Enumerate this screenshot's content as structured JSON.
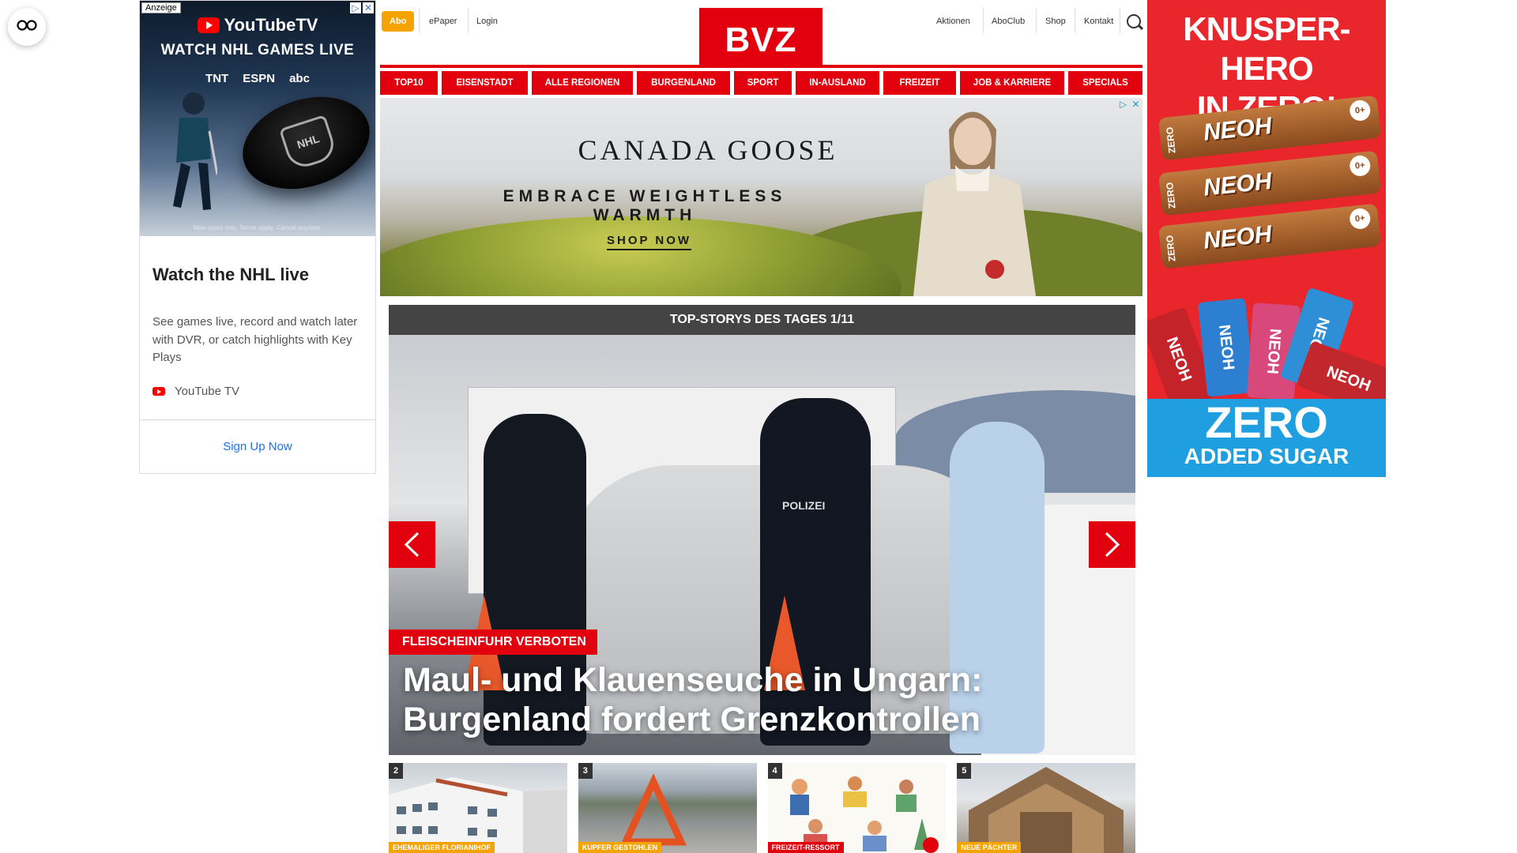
{
  "floating_button": {
    "icon": "glasses-icon"
  },
  "left_ad": {
    "badge": "Anzeige",
    "brand": "YouTubeTV",
    "headline": "WATCH NHL GAMES LIVE",
    "networks": [
      "TNT",
      "ESPN",
      "abc"
    ],
    "puck_label": "NHL",
    "fine_print": "New users only. Terms apply. Cancel anytime.",
    "title": "Watch the NHL live",
    "description": "See games live, record and watch later with DVR, or catch highlights with Key Plays",
    "advertiser": "YouTube TV",
    "cta": "Sign Up Now",
    "cta_color": "#1a73e8"
  },
  "header": {
    "abo": "Abo",
    "links_left": [
      "ePaper",
      "Login"
    ],
    "logo": "BVZ",
    "links_right": [
      "Aktionen",
      "AboClub",
      "Shop",
      "Kontakt"
    ],
    "brand_color": "#e2000f",
    "abo_color": "#f5a300"
  },
  "nav": [
    "TOP10",
    "EISENSTADT",
    "ALLE REGIONEN",
    "BURGENLAND",
    "SPORT",
    "IN-AUSLAND",
    "FREIZEIT",
    "JOB & KARRIERE",
    "SPECIALS"
  ],
  "banner_ad": {
    "brand": "CANADA GOOSE",
    "tagline": "EMBRACE WEIGHTLESS WARMTH",
    "cta": "SHOP NOW"
  },
  "top_stories": {
    "heading": "TOP-STORYS DES TAGES 1/11",
    "main": {
      "kicker": "FLEISCHEINFUHR VERBOTEN",
      "headline": "Maul- und Klauenseuche in Ungarn: Burgenland fordert Grenzkontrollen",
      "badge_left": "POLIZEI",
      "badge_right": "POLIZEI"
    },
    "thumbs": [
      {
        "num": "2",
        "tag": "EHEMALIGER FLORIANIHOF",
        "tag_color": "orange"
      },
      {
        "num": "3",
        "tag": "KUPFER GESTOHLEN",
        "tag_color": "orange"
      },
      {
        "num": "4",
        "tag": "FREIZEIT-RESSORT",
        "tag_color": "red"
      },
      {
        "num": "5",
        "tag": "NEUE PÄCHTER",
        "tag_color": "orange"
      }
    ]
  },
  "right_ad": {
    "title_line1": "KNUSPER-HERO",
    "title_line2": "IN ZERO!",
    "bars": [
      {
        "brand": "NEOH",
        "zero": "ZERO",
        "badge": "0+"
      },
      {
        "brand": "NEOH",
        "zero": "ZERO",
        "badge": "0+"
      },
      {
        "brand": "NEOH",
        "zero": "ZERO",
        "badge": "0+"
      }
    ],
    "packs": [
      "NEOH",
      "NEOH",
      "NEOH",
      "NEOH",
      "NEOH"
    ],
    "bottom_line1": "ZERO",
    "bottom_line2": "ADDED SUGAR"
  }
}
